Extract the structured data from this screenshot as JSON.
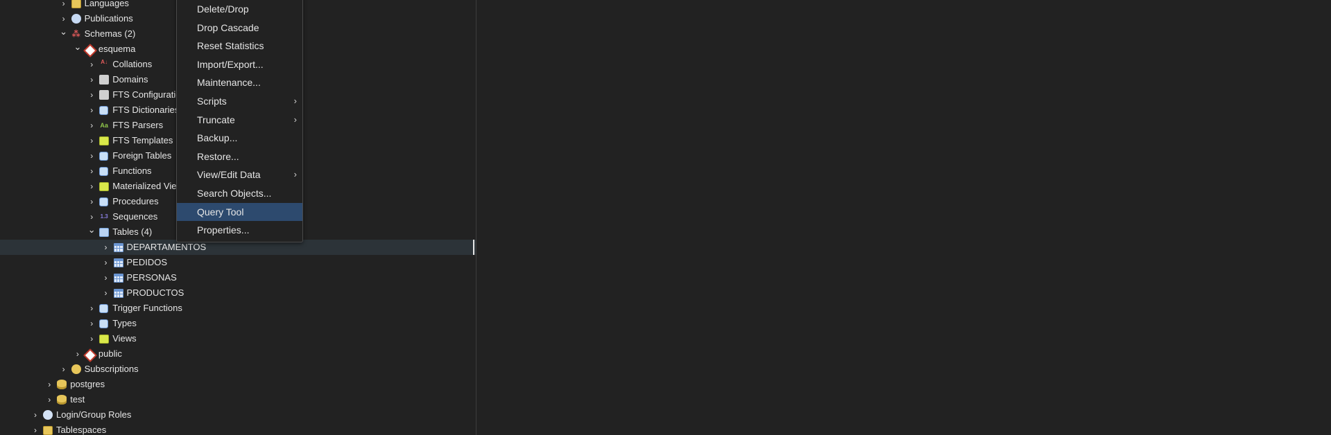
{
  "tree": [
    {
      "label": "Languages",
      "depth": 4,
      "expanded": false,
      "icon": "languages-icon",
      "y": -6
    },
    {
      "label": "Publications",
      "depth": 4,
      "expanded": false,
      "icon": "publications-icon"
    },
    {
      "label": "Schemas (2)",
      "depth": 4,
      "expanded": true,
      "icon": "schemas-icon"
    },
    {
      "label": "esquema",
      "depth": 5,
      "expanded": true,
      "icon": "schema-icon"
    },
    {
      "label": "Collations",
      "depth": 6,
      "expanded": false,
      "icon": "collations-icon"
    },
    {
      "label": "Domains",
      "depth": 6,
      "expanded": false,
      "icon": "domains-icon"
    },
    {
      "label": "FTS Configurations",
      "depth": 6,
      "expanded": false,
      "icon": "fts-configurations-icon"
    },
    {
      "label": "FTS Dictionaries",
      "depth": 6,
      "expanded": false,
      "icon": "fts-dictionaries-icon"
    },
    {
      "label": "FTS Parsers",
      "depth": 6,
      "expanded": false,
      "icon": "fts-parsers-icon"
    },
    {
      "label": "FTS Templates",
      "depth": 6,
      "expanded": false,
      "icon": "fts-templates-icon"
    },
    {
      "label": "Foreign Tables",
      "depth": 6,
      "expanded": false,
      "icon": "foreign-tables-icon"
    },
    {
      "label": "Functions",
      "depth": 6,
      "expanded": false,
      "icon": "functions-icon"
    },
    {
      "label": "Materialized Views",
      "depth": 6,
      "expanded": false,
      "icon": "materialized-views-icon"
    },
    {
      "label": "Procedures",
      "depth": 6,
      "expanded": false,
      "icon": "procedures-icon"
    },
    {
      "label": "Sequences",
      "depth": 6,
      "expanded": false,
      "icon": "sequences-icon"
    },
    {
      "label": "Tables (4)",
      "depth": 6,
      "expanded": true,
      "icon": "tables-icon"
    },
    {
      "label": "DEPARTAMENTOS",
      "depth": 7,
      "expanded": false,
      "icon": "table-icon",
      "selected": true
    },
    {
      "label": "PEDIDOS",
      "depth": 7,
      "expanded": false,
      "icon": "table-icon"
    },
    {
      "label": "PERSONAS",
      "depth": 7,
      "expanded": false,
      "icon": "table-icon"
    },
    {
      "label": "PRODUCTOS",
      "depth": 7,
      "expanded": false,
      "icon": "table-icon"
    },
    {
      "label": "Trigger Functions",
      "depth": 6,
      "expanded": false,
      "icon": "trigger-functions-icon"
    },
    {
      "label": "Types",
      "depth": 6,
      "expanded": false,
      "icon": "types-icon"
    },
    {
      "label": "Views",
      "depth": 6,
      "expanded": false,
      "icon": "views-icon"
    },
    {
      "label": "public",
      "depth": 5,
      "expanded": false,
      "icon": "schema-icon"
    },
    {
      "label": "Subscriptions",
      "depth": 4,
      "expanded": false,
      "icon": "subscriptions-icon"
    },
    {
      "label": "postgres",
      "depth": 3,
      "expanded": false,
      "icon": "database-icon"
    },
    {
      "label": "test",
      "depth": 3,
      "expanded": false,
      "icon": "database-icon"
    },
    {
      "label": "Login/Group Roles",
      "depth": 2,
      "expanded": false,
      "icon": "login-group-roles-icon"
    },
    {
      "label": "Tablespaces",
      "depth": 2,
      "expanded": false,
      "icon": "tablespaces-icon"
    }
  ],
  "context_menu": {
    "items": [
      {
        "label": "Delete/Drop",
        "submenu": false
      },
      {
        "label": "Drop Cascade",
        "submenu": false
      },
      {
        "label": "Reset Statistics",
        "submenu": false
      },
      {
        "label": "Import/Export...",
        "submenu": false
      },
      {
        "label": "Maintenance...",
        "submenu": false
      },
      {
        "label": "Scripts",
        "submenu": true
      },
      {
        "label": "Truncate",
        "submenu": true
      },
      {
        "label": "Backup...",
        "submenu": false
      },
      {
        "label": "Restore...",
        "submenu": false
      },
      {
        "label": "View/Edit Data",
        "submenu": true
      },
      {
        "label": "Search Objects...",
        "submenu": false
      },
      {
        "label": "Query Tool",
        "submenu": false,
        "active": true
      },
      {
        "label": "Properties...",
        "submenu": false
      }
    ],
    "submenu_glyph": "›"
  },
  "glyphs": {
    "collapsed": "›",
    "expanded": "⌄"
  },
  "colors": {
    "background": "#222222",
    "selected_row": "#2c3338",
    "menu_active": "#2d4a6e"
  }
}
